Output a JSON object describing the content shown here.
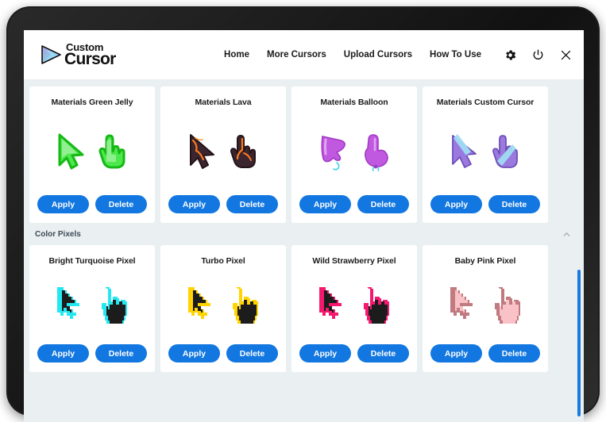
{
  "window": {
    "app_name": "Custom Cursor",
    "logo": {
      "line1": "Custom",
      "line2": "Cursor"
    }
  },
  "header": {
    "nav": [
      {
        "label": "Home",
        "name": "nav-home"
      },
      {
        "label": "More Cursors",
        "name": "nav-more-cursors"
      },
      {
        "label": "Upload Cursors",
        "name": "nav-upload-cursors"
      },
      {
        "label": "How To Use",
        "name": "nav-how-to-use"
      }
    ],
    "icons": [
      {
        "name": "gear-icon",
        "label": "Settings"
      },
      {
        "name": "power-icon",
        "label": "Power"
      },
      {
        "name": "close-icon",
        "label": "Close"
      }
    ]
  },
  "buttons": {
    "apply": "Apply",
    "delete": "Delete"
  },
  "colors": {
    "accent_blue": "#1277e0",
    "page_background": "#eaf0f2",
    "card_background": "#ffffff",
    "frame": "#1c1c1c",
    "scrollbar": "#1a7ae0"
  },
  "sections": [
    {
      "title": "",
      "collapsible": false,
      "cards": [
        {
          "title": "Materials Green Jelly",
          "style": "jelly",
          "color": "#3de03d",
          "color2": "#8ff08f"
        },
        {
          "title": "Materials Lava",
          "style": "lava",
          "color": "#4a3038",
          "color2": "#ff7a1a"
        },
        {
          "title": "Materials Balloon",
          "style": "balloon",
          "color": "#c158e0",
          "color2": "#e49bf5"
        },
        {
          "title": "Materials Custom Cursor",
          "style": "custom",
          "color": "#9b7ae0",
          "color2": "#9fdcf2"
        }
      ]
    },
    {
      "title": "Color Pixels",
      "collapsible": true,
      "chevron": "chevron-up-icon",
      "cards": [
        {
          "title": "Bright Turquoise Pixel",
          "style": "pixel",
          "color": "#1c1c1c",
          "color2": "#24e8f0"
        },
        {
          "title": "Turbo Pixel",
          "style": "pixel",
          "color": "#1c1c1c",
          "color2": "#ffd400"
        },
        {
          "title": "Wild Strawberry Pixel",
          "style": "pixel",
          "color": "#1c1c1c",
          "color2": "#f5186f"
        },
        {
          "title": "Baby Pink Pixel",
          "style": "pixel",
          "color": "#f9c2c6",
          "color2": "#c07a80"
        }
      ]
    }
  ],
  "scrollbar": {
    "visible": true
  }
}
